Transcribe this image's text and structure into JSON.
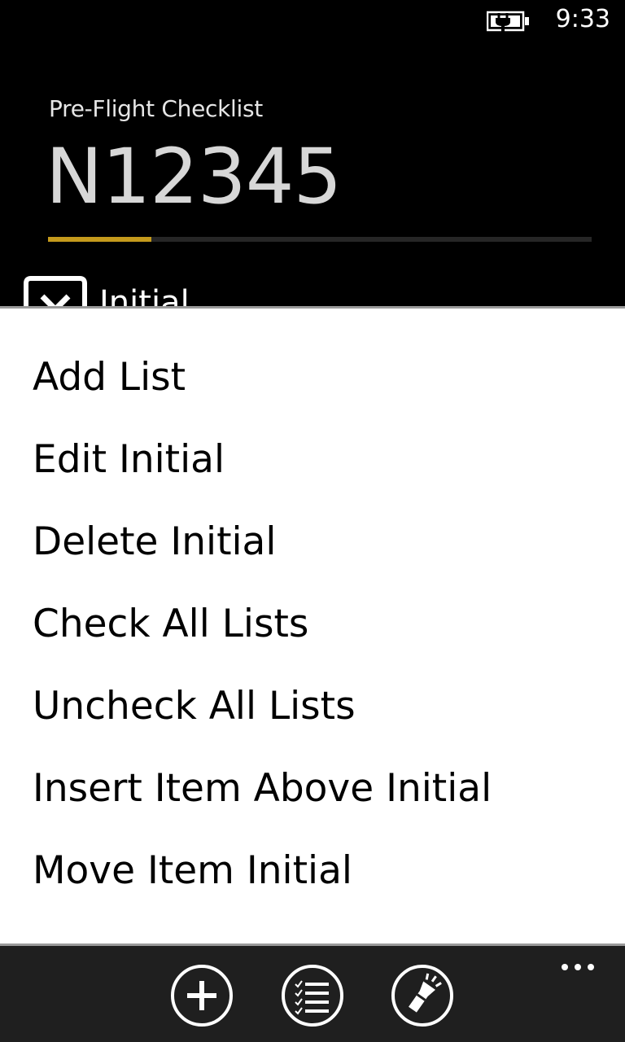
{
  "status_bar": {
    "time": "9:33",
    "battery_icon": "battery-charging-icon"
  },
  "header": {
    "subtitle": "Pre-Flight Checklist",
    "title": "N12345",
    "progress_fraction": 0.19,
    "accent_color": "#c49a1c"
  },
  "background_list": {
    "visible_item_label": "Initial",
    "item_icon": "unchecked-box-icon"
  },
  "context_menu": {
    "items": [
      "Add List",
      "Edit Initial",
      "Delete Initial",
      "Check All Lists",
      "Uncheck All Lists",
      "Insert Item Above Initial",
      "Move Item Initial"
    ]
  },
  "app_bar": {
    "buttons": [
      {
        "icon": "add-icon"
      },
      {
        "icon": "checklist-icon"
      },
      {
        "icon": "flashlight-icon"
      }
    ],
    "more_icon": "ellipsis-icon"
  }
}
